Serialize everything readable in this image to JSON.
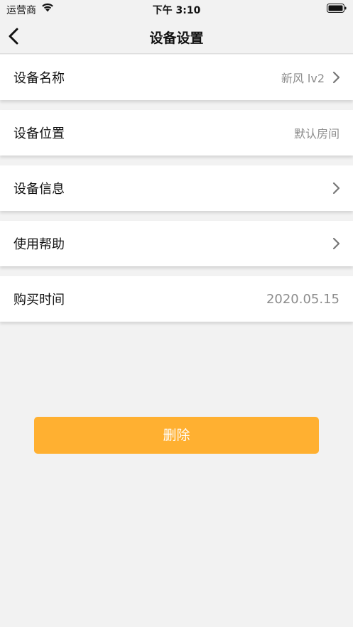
{
  "status_bar": {
    "carrier": "运营商",
    "time": "下午 3:10"
  },
  "nav": {
    "title": "设备设置"
  },
  "rows": [
    {
      "label": "设备名称",
      "value": "新风 lv2"
    },
    {
      "label": "设备位置",
      "value": "默认房间"
    },
    {
      "label": "设备信息",
      "value": ""
    },
    {
      "label": "使用帮助",
      "value": ""
    },
    {
      "label": "购买时间",
      "value": "2020.05.15"
    }
  ],
  "delete_button": {
    "label": "删除",
    "color": "#ffb031"
  },
  "icons": {
    "wifi": "wifi-icon",
    "battery": "battery-icon",
    "back": "chevron-left-icon",
    "chevron": "chevron-right-icon"
  }
}
